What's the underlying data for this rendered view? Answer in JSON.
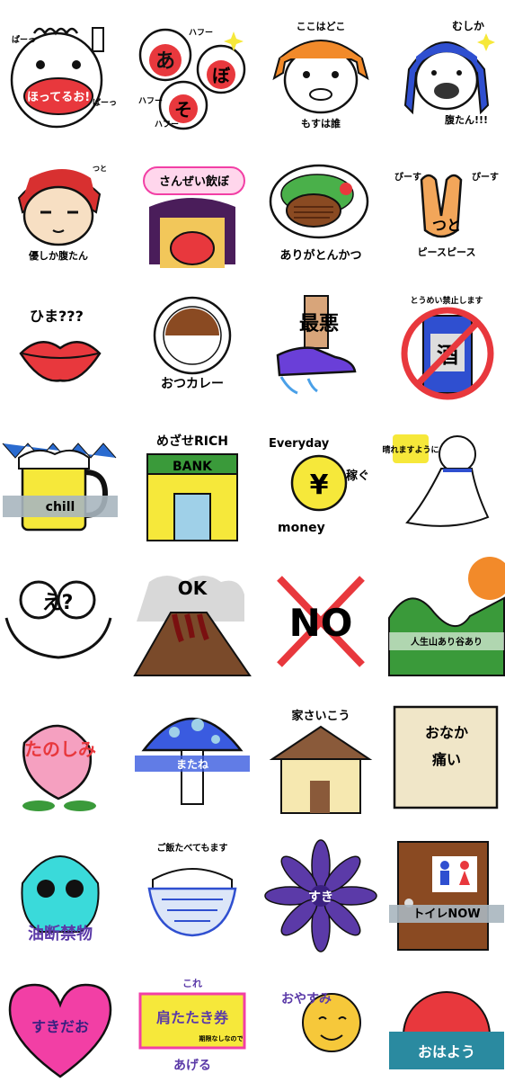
{
  "stickers": [
    {
      "id": "s1",
      "text": [
        "ぱーっ",
        "ほってるお!",
        "ばーっ"
      ],
      "icon": "screaming-baby"
    },
    {
      "id": "s2",
      "text": [
        "あ",
        "そ",
        "ぼ",
        "ハフー",
        "ハフー",
        "ハフー"
      ],
      "icon": "baby-faces-play"
    },
    {
      "id": "s3",
      "text": [
        "ここはどこ",
        "もすは誰"
      ],
      "icon": "orange-hair-girl"
    },
    {
      "id": "s4",
      "text": [
        "むしか",
        "腹たん!!!"
      ],
      "icon": "blue-braids-girl"
    },
    {
      "id": "s5",
      "text": [
        "つと",
        "優しか腹たん"
      ],
      "icon": "red-hair-boy"
    },
    {
      "id": "s6",
      "text": [
        "さんぜい飲ぼ"
      ],
      "icon": "purple-hair-girl"
    },
    {
      "id": "s7",
      "text": [
        "ありがとんかつ"
      ],
      "icon": "tonkatsu"
    },
    {
      "id": "s8",
      "text": [
        "ぴーす",
        "ぴーす",
        "つと",
        "ピースピース"
      ],
      "icon": "peace-hand"
    },
    {
      "id": "s9",
      "text": [
        "ひま???"
      ],
      "icon": "red-lips"
    },
    {
      "id": "s10",
      "text": [
        "おつカレー"
      ],
      "icon": "curry-plate"
    },
    {
      "id": "s11",
      "text": [
        "最悪"
      ],
      "icon": "shoe-stepping"
    },
    {
      "id": "s12",
      "text": [
        "とうめい禁止します",
        "酒"
      ],
      "icon": "no-alcohol"
    },
    {
      "id": "s13",
      "text": [
        "chill"
      ],
      "icon": "beer-mug"
    },
    {
      "id": "s14",
      "text": [
        "めざせRICH",
        "BANK"
      ],
      "icon": "bank"
    },
    {
      "id": "s15",
      "text": [
        "Everyday",
        "¥",
        "稼ぐ",
        "money"
      ],
      "icon": "yen-coin"
    },
    {
      "id": "s16",
      "text": [
        "晴れますように"
      ],
      "icon": "teru-teru-bozu"
    },
    {
      "id": "s17",
      "text": [
        "え?"
      ],
      "icon": "surprised-face"
    },
    {
      "id": "s18",
      "text": [
        "OK"
      ],
      "icon": "volcano"
    },
    {
      "id": "s19",
      "text": [
        "NO"
      ],
      "icon": "no-cross"
    },
    {
      "id": "s20",
      "text": [
        "人生山あり谷あり"
      ],
      "icon": "mountain-sun"
    },
    {
      "id": "s21",
      "text": [
        "たのしみ"
      ],
      "icon": "peach"
    },
    {
      "id": "s22",
      "text": [
        "またね"
      ],
      "icon": "mushroom"
    },
    {
      "id": "s23",
      "text": [
        "家さいこう"
      ],
      "icon": "house"
    },
    {
      "id": "s24",
      "text": [
        "おなか",
        "痛い"
      ],
      "icon": "sign-board"
    },
    {
      "id": "s25",
      "text": [
        "油断禁物"
      ],
      "icon": "skull"
    },
    {
      "id": "s26",
      "text": [
        "ご飯たべてもます"
      ],
      "icon": "rice-bowl"
    },
    {
      "id": "s27",
      "text": [
        "すき"
      ],
      "icon": "purple-flower"
    },
    {
      "id": "s28",
      "text": [
        "トイレNOW"
      ],
      "icon": "toilet-door"
    },
    {
      "id": "s29",
      "text": [
        "すきだお"
      ],
      "icon": "heart"
    },
    {
      "id": "s30",
      "text": [
        "これ",
        "肩たたき券",
        "期限なしなので",
        "あげる"
      ],
      "icon": "ticket"
    },
    {
      "id": "s31",
      "text": [
        "おやすみ"
      ],
      "icon": "moon-sleep"
    },
    {
      "id": "s32",
      "text": [
        "おはよう"
      ],
      "icon": "sunrise"
    }
  ],
  "colors": {
    "red": "#e8383d",
    "blue": "#2f4fd0",
    "yellow": "#f6e83a",
    "purple": "#5b3aa8",
    "pink": "#f23fa5",
    "green": "#3a9a3a",
    "teal": "#2a8aa0"
  }
}
